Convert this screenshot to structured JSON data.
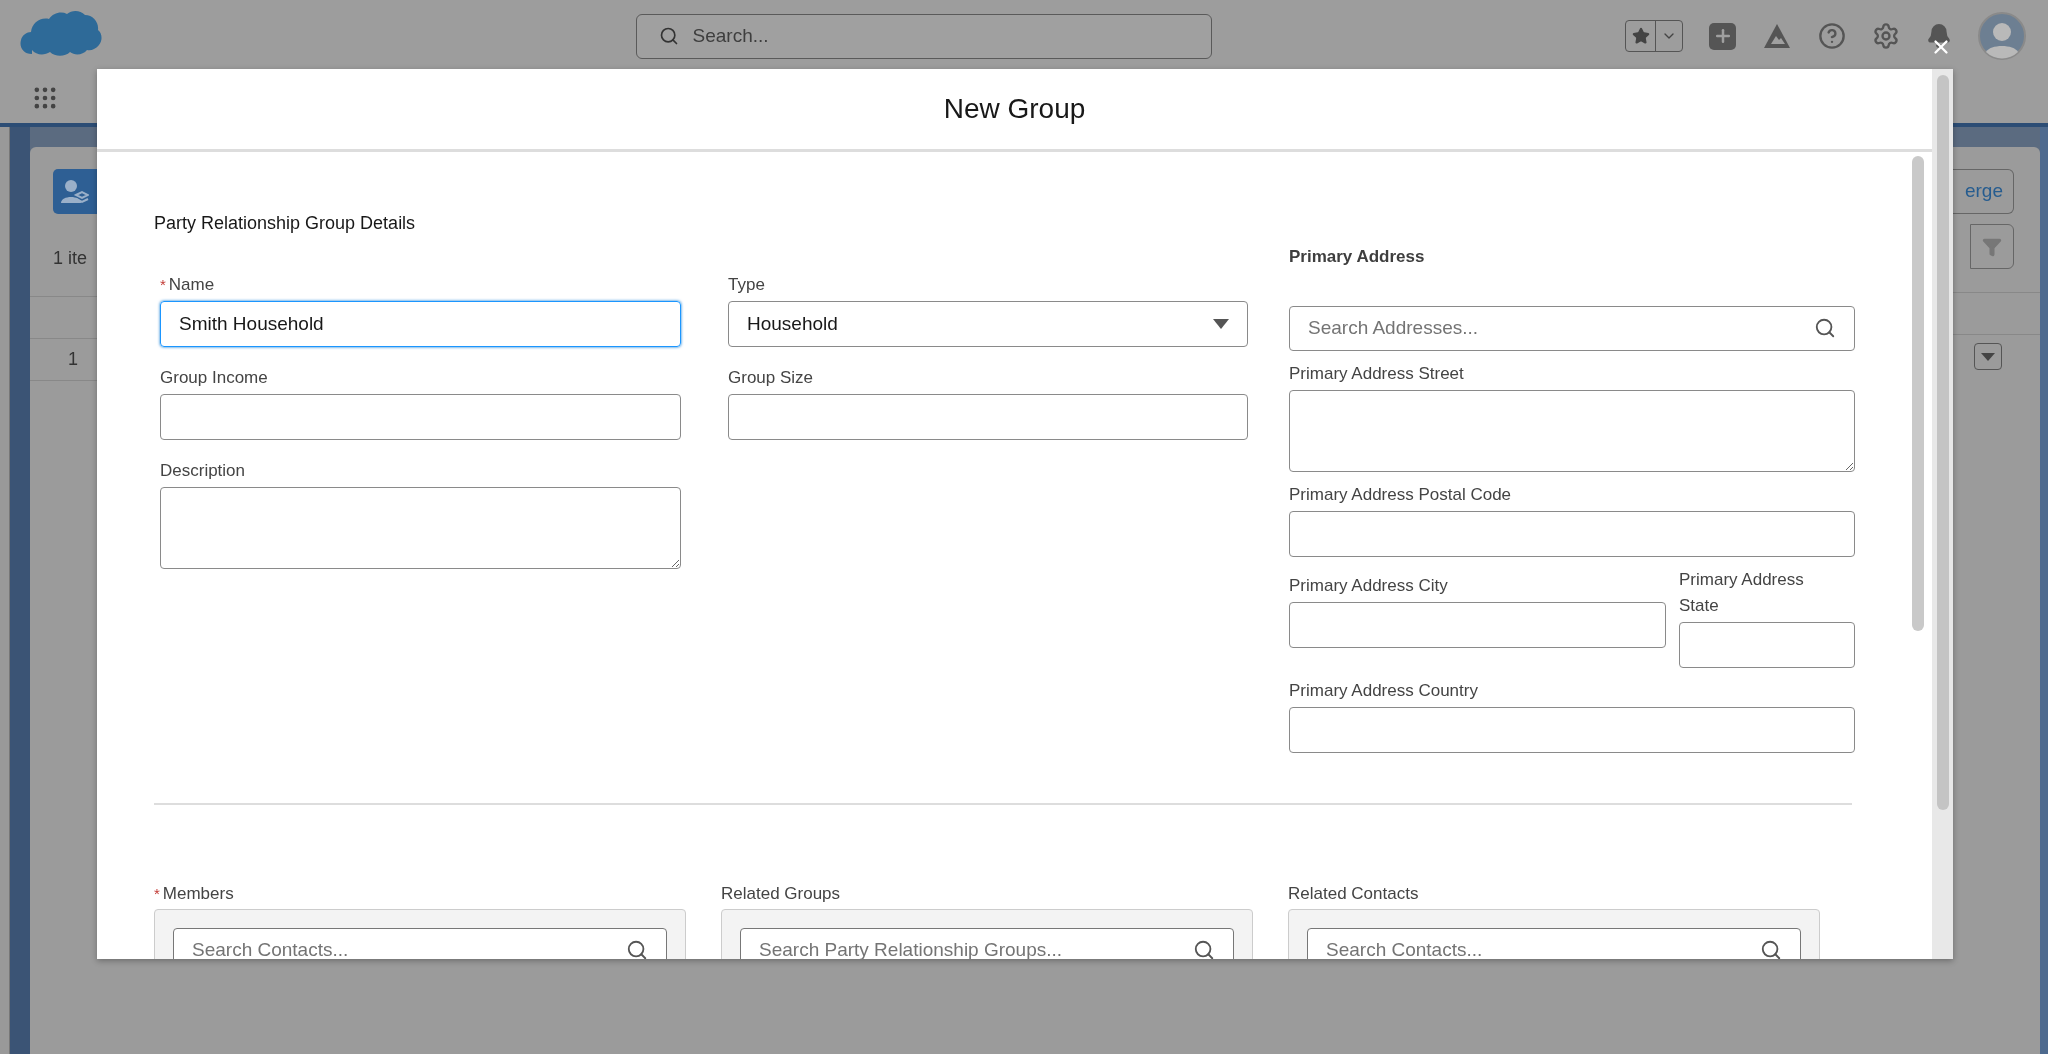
{
  "top_bar": {
    "search_placeholder": "Search..."
  },
  "background": {
    "count_text": "1 ite",
    "row_number": "1",
    "button_text": "erge"
  },
  "modal": {
    "title": "New Group",
    "required_mark": "*",
    "section_title": "Party Relationship Group Details",
    "columns": [
      {
        "fields": [
          {
            "kind": "text",
            "label": "Name",
            "required": true,
            "focused": true,
            "value": "Smith Household"
          },
          {
            "kind": "text",
            "label": "Group Income",
            "required": false,
            "focused": false
          },
          {
            "kind": "textarea",
            "label": "Description",
            "required": false,
            "focused": false
          }
        ]
      },
      {
        "fields": [
          {
            "kind": "select",
            "label": "Type",
            "required": false,
            "focused": false,
            "value": "Household"
          },
          {
            "kind": "text",
            "label": "Group Size",
            "required": false,
            "focused": false
          }
        ]
      },
      {
        "heading": "Primary Address",
        "fields": [
          {
            "kind": "search",
            "placeholder": "Search Addresses..."
          },
          {
            "kind": "textarea",
            "label": "Primary Address Street",
            "required": false,
            "focused": false
          },
          {
            "kind": "text",
            "label": "Primary Address Postal Code",
            "required": false,
            "focused": false
          },
          {
            "kind": "row",
            "fields": [
              {
                "kind": "text",
                "label": "Primary Address City",
                "required": false,
                "focused": false
              },
              {
                "kind": "text",
                "label": "Primary Address State",
                "required": false,
                "focused": false
              }
            ]
          },
          {
            "kind": "text",
            "label": "Primary Address Country",
            "required": false,
            "focused": false
          }
        ]
      }
    ],
    "lookups": [
      {
        "label": "Members",
        "required": true,
        "placeholder": "Search Contacts..."
      },
      {
        "label": "Related Groups",
        "required": false,
        "placeholder": "Search Party Relationship Groups..."
      },
      {
        "label": "Related Contacts",
        "required": false,
        "placeholder": "Search Contacts..."
      }
    ]
  }
}
